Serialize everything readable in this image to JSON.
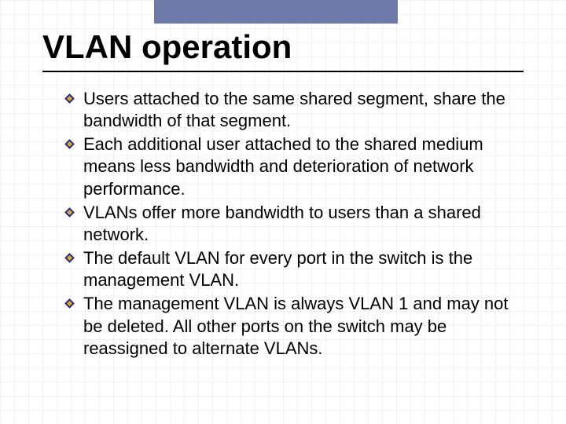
{
  "title": "VLAN operation",
  "bullets": [
    "Users attached to the same shared segment, share the bandwidth of that segment.",
    "Each additional user attached to the shared medium means less bandwidth and deterioration of network performance.",
    "VLANs offer more bandwidth to users than a shared network.",
    "The default VLAN for every port in the switch is the management VLAN.",
    "The management VLAN is always VLAN 1 and may not be deleted. All other ports on the switch may be reassigned to alternate VLANs."
  ],
  "colors": {
    "topbar": "#6e7ba9",
    "bullet_outer": "#2a2f6e",
    "bullet_inner": "#d9a93f"
  }
}
